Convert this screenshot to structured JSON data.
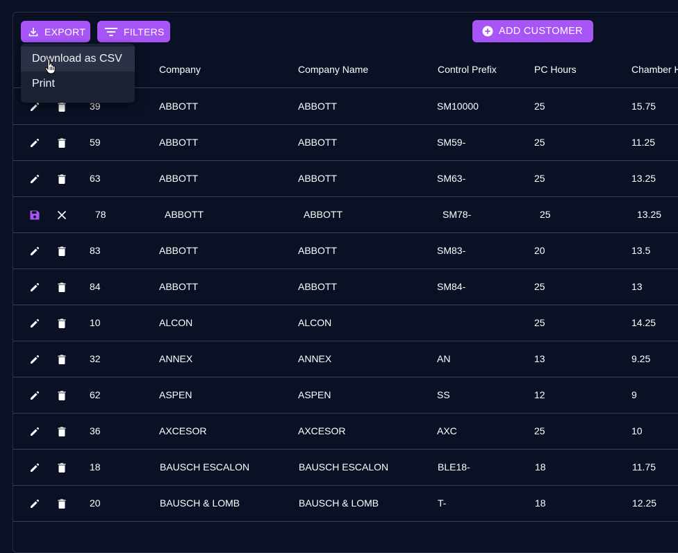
{
  "toolbar": {
    "export_label": "EXPORT",
    "filters_label": "FILTERS",
    "add_customer_label": "ADD CUSTOMER"
  },
  "export_menu": {
    "items": [
      {
        "label": "Download as CSV"
      },
      {
        "label": "Print"
      }
    ]
  },
  "table": {
    "columns": [
      "Company",
      "Company Name",
      "Control Prefix",
      "PC Hours",
      "Chamber H"
    ],
    "rows": [
      {
        "id": "39",
        "company": "ABBOTT",
        "company_name": "ABBOTT",
        "control_prefix": "SM10000",
        "pc_hours": "25",
        "chamber": "15.75"
      },
      {
        "id": "59",
        "company": "ABBOTT",
        "company_name": "ABBOTT",
        "control_prefix": "SM59-",
        "pc_hours": "25",
        "chamber": "11.25"
      },
      {
        "id": "63",
        "company": "ABBOTT",
        "company_name": "ABBOTT",
        "control_prefix": "SM63-",
        "pc_hours": "25",
        "chamber": "13.25"
      },
      {
        "id": "78",
        "company": "ABBOTT",
        "company_name": "ABBOTT",
        "control_prefix": "SM78-",
        "pc_hours": "25",
        "chamber": "13.25"
      },
      {
        "id": "83",
        "company": "ABBOTT",
        "company_name": "ABBOTT",
        "control_prefix": "SM83-",
        "pc_hours": "20",
        "chamber": "13.5"
      },
      {
        "id": "84",
        "company": "ABBOTT",
        "company_name": "ABBOTT",
        "control_prefix": "SM84-",
        "pc_hours": "25",
        "chamber": "13"
      },
      {
        "id": "10",
        "company": "ALCON",
        "company_name": "ALCON",
        "control_prefix": "",
        "pc_hours": "25",
        "chamber": "14.25"
      },
      {
        "id": "32",
        "company": "ANNEX",
        "company_name": "ANNEX",
        "control_prefix": "AN",
        "pc_hours": "13",
        "chamber": "9.25"
      },
      {
        "id": "62",
        "company": "ASPEN",
        "company_name": "ASPEN",
        "control_prefix": "SS",
        "pc_hours": "12",
        "chamber": "9"
      },
      {
        "id": "36",
        "company": "AXCESOR",
        "company_name": "AXCESOR",
        "control_prefix": "AXC",
        "pc_hours": "25",
        "chamber": "10"
      },
      {
        "id": "18",
        "company": "BAUSCH ESCALON",
        "company_name": "BAUSCH ESCALON",
        "control_prefix": "BLE18-",
        "pc_hours": "18",
        "chamber": "11.75"
      },
      {
        "id": "20",
        "company": "BAUSCH & LOMB",
        "company_name": "BAUSCH & LOMB",
        "control_prefix": "T-",
        "pc_hours": "18",
        "chamber": "12.25"
      }
    ]
  },
  "colors": {
    "accent": "#a855f7",
    "background": "#0b1225",
    "divider": "#3a4150"
  },
  "icons": {
    "export": "download-icon",
    "filters": "filter-lines-icon",
    "add": "plus-circle-icon",
    "edit": "pencil-icon",
    "delete": "trash-icon",
    "save": "floppy-disk-icon",
    "cancel": "close-icon"
  }
}
